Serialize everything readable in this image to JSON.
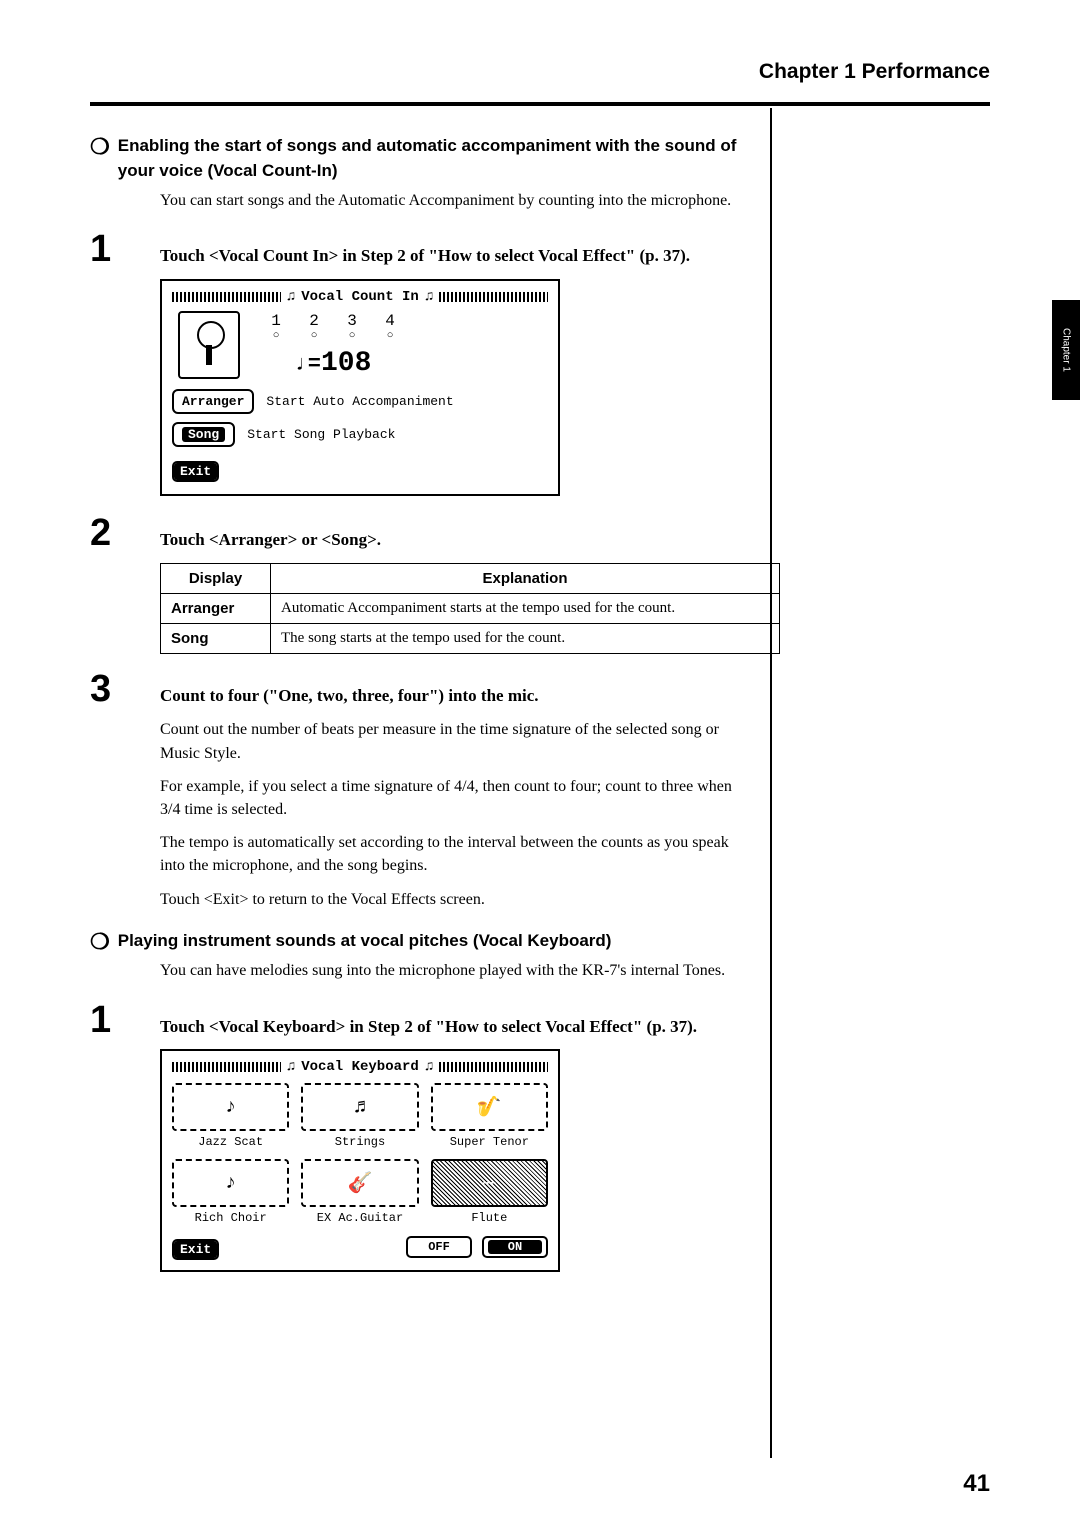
{
  "chapter_header": "Chapter 1 Performance",
  "side_tab": "Chapter 1",
  "section1": {
    "heading": "Enabling the start of songs and automatic accompaniment with the sound of your voice (Vocal Count-In)",
    "intro": "You can start songs and the Automatic Accompaniment by counting into the microphone.",
    "step1": "Touch <Vocal Count In> in Step 2 of \"How to select Vocal Effect\" (p. 37).",
    "lcd": {
      "title": "Vocal Count In",
      "counts": [
        "1",
        "2",
        "3",
        "4"
      ],
      "tempo_prefix": "♩=",
      "tempo_value": "108",
      "arranger_btn": "Arranger",
      "arranger_desc": "Start Auto Accompaniment",
      "song_btn": "Song",
      "song_desc": "Start Song Playback",
      "exit": "Exit"
    },
    "step2": "Touch <Arranger> or <Song>.",
    "table": {
      "h1": "Display",
      "h2": "Explanation",
      "r1k": "Arranger",
      "r1v": "Automatic Accompaniment starts at the tempo used for the count.",
      "r2k": "Song",
      "r2v": "The song starts at the tempo used for the count."
    },
    "step3": "Count to four (\"One, two, three, four\") into the mic.",
    "step3_body1": "Count out the number of beats per measure in the time signature of the selected song or Music Style.",
    "step3_body2": "For example, if you select a time signature of 4/4, then count to four; count to three when 3/4 time is selected.",
    "step3_body3": "The tempo is automatically set according to the interval between the counts as you speak into the microphone, and the song begins.",
    "step3_body4": "Touch <Exit> to return to the Vocal Effects screen."
  },
  "section2": {
    "heading": "Playing instrument sounds at vocal pitches (Vocal Keyboard)",
    "intro": "You can have melodies sung into the microphone played with the KR-7's internal Tones.",
    "step1": "Touch <Vocal Keyboard> in Step 2 of \"How to select Vocal Effect\" (p. 37).",
    "lcd": {
      "title": "Vocal Keyboard",
      "cells": [
        {
          "label": "Jazz Scat"
        },
        {
          "label": "Strings"
        },
        {
          "label": "Super Tenor"
        },
        {
          "label": "Rich Choir"
        },
        {
          "label": "EX Ac.Guitar"
        },
        {
          "label": "Flute",
          "selected": true
        }
      ],
      "exit": "Exit",
      "off": "OFF",
      "on": "ON"
    }
  },
  "page_number": "41"
}
